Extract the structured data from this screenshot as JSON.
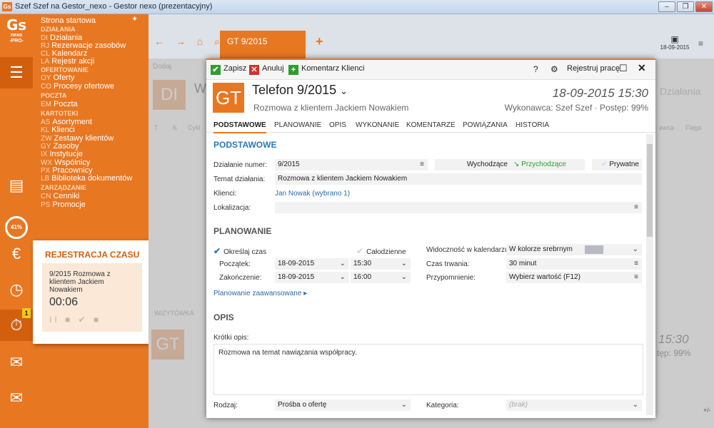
{
  "window": {
    "title": "Szef Szef na Gestor_nexo - Gestor nexo (prezentacyjny)",
    "app_icon": "Gs",
    "buttons": [
      "minimize-icon",
      "maximize-icon",
      "close-icon"
    ]
  },
  "rail": {
    "logo_main": "Gs",
    "logo_sub1": "nexo",
    "logo_sub2": "-PRO-",
    "progress_label": "41%",
    "timer_badge": "1",
    "icons": [
      "menu-icon",
      "document-icon",
      "progress-ring",
      "money-icon",
      "calendar-clock-icon",
      "stopwatch-icon",
      "mail-send-icon",
      "mail-icon"
    ]
  },
  "nav": {
    "start": "Strona startowa",
    "groups": [
      {
        "head": "DZIAŁANIA",
        "items": [
          {
            "code": "DI",
            "label": "Działania"
          },
          {
            "code": "RJ",
            "label": "Rezerwacje zasobów"
          },
          {
            "code": "CL",
            "label": "Kalendarz"
          },
          {
            "code": "LA",
            "label": "Rejestr akcji"
          }
        ]
      },
      {
        "head": "OFERTOWANIE",
        "items": [
          {
            "code": "OY",
            "label": "Oferty"
          },
          {
            "code": "CO",
            "label": "Procesy ofertowe"
          }
        ]
      },
      {
        "head": "POCZTA",
        "items": [
          {
            "code": "EM",
            "label": "Poczta"
          }
        ]
      },
      {
        "head": "KARTOTEKI",
        "items": [
          {
            "code": "AS",
            "label": "Asortyment"
          },
          {
            "code": "KL",
            "label": "Klienci"
          },
          {
            "code": "ZW",
            "label": "Zestawy klientów"
          },
          {
            "code": "GY",
            "label": "Zasoby"
          },
          {
            "code": "IX",
            "label": "Instytucje"
          },
          {
            "code": "WX",
            "label": "Wspólnicy"
          },
          {
            "code": "PX",
            "label": "Pracownicy"
          },
          {
            "code": "LB",
            "label": "Biblioteka dokumentów"
          }
        ]
      },
      {
        "head": "ZARZĄDZANIE",
        "items": [
          {
            "code": "CN",
            "label": "Cenniki"
          },
          {
            "code": "PS",
            "label": "Promocje"
          }
        ]
      }
    ]
  },
  "rejestracja": {
    "title": "REJESTRACJA CZASU",
    "desc": "9/2015 Rozmowa z klientem Jackiem Nowakiem",
    "time": "00:06",
    "controls": "II ■ ✔ ■"
  },
  "bg": {
    "tab": "GT 9/2015",
    "date": "18-09-2015",
    "add_label": "Dodaj",
    "di": "DI",
    "heading_frag": "W",
    "col_t": "T",
    "col_k": "K",
    "col_cykl": "Cykl",
    "wizytowka": "WIZYTÓWKA",
    "dzialania_frag": "Działania",
    "fl_col1": "awca",
    "fl_col2": "Flaga",
    "time_frag": "15:30",
    "progress_frag": "tęp: 99%",
    "gt_frag": "GT",
    "plusminus": "+/-"
  },
  "dialog": {
    "toolbar": {
      "save": "Zapisz",
      "cancel": "Anuluj",
      "comment": "Komentarz",
      "clients": "Klienci",
      "help": "?",
      "register": "Rejestruj pracę"
    },
    "badge": "GT",
    "title": "Telefon 9/2015",
    "subtitle": "Rozmowa z klientem Jackiem Nowakiem",
    "datetime": "18-09-2015 15:30",
    "executor": "Wykonawca: Szef Szef · Postęp: 99%",
    "tabs": [
      "PODSTAWOWE",
      "PLANOWANIE",
      "OPIS",
      "WYKONANIE",
      "KOMENTARZE",
      "POWIĄZANIA",
      "HISTORIA"
    ],
    "podstawowe": {
      "header": "PODSTAWOWE",
      "dzialanie_label": "Działanie numer:",
      "dzialanie_value": "9/2015",
      "wychodzace": "Wychodzące",
      "przychodzace": "Przychodzące",
      "prywatne": "Prywatne",
      "temat_label": "Temat działania:",
      "temat_value": "Rozmowa z klientem Jackiem Nowakiem",
      "klienci_label": "Klienci:",
      "klienci_value": "Jan Nowak (wybrano 1)",
      "lokalizacja_label": "Lokalizacja:",
      "lokalizacja_value": ""
    },
    "planowanie": {
      "header": "PLANOWANIE",
      "okreslaj": "Określaj czas",
      "calodzienne": "Całodzienne",
      "widocznosc_label": "Widoczność w kalendarzu:",
      "widocznosc_value": "W kolorze srebrnym",
      "poczatek_label": "Początek:",
      "poczatek_date": "18-09-2015",
      "poczatek_time": "15:30",
      "zakonczenie_label": "Zakończenie:",
      "zakonczenie_date": "18-09-2015",
      "zakonczenie_time": "16:00",
      "czas_label": "Czas trwania:",
      "czas_value": "30 minut",
      "przypomnienie_label": "Przypomnienie:",
      "przypomnienie_value": "Wybierz wartość (F12)",
      "advanced": "Planowanie zaawansowane ▸"
    },
    "opis": {
      "header": "OPIS",
      "krotki_label": "Krótki opis:",
      "krotki_value": "Rozmowa na temat nawiązania współpracy.",
      "rodzaj_label": "Rodzaj:",
      "rodzaj_value": "Prośba o ofertę",
      "kategoria_label": "Kategoria:",
      "kategoria_value": "(brak)"
    }
  },
  "colors": {
    "accent": "#e87722",
    "accent_dark": "#d15f0e",
    "link": "#2a6ca8",
    "section_blue": "#2a7ab8"
  }
}
